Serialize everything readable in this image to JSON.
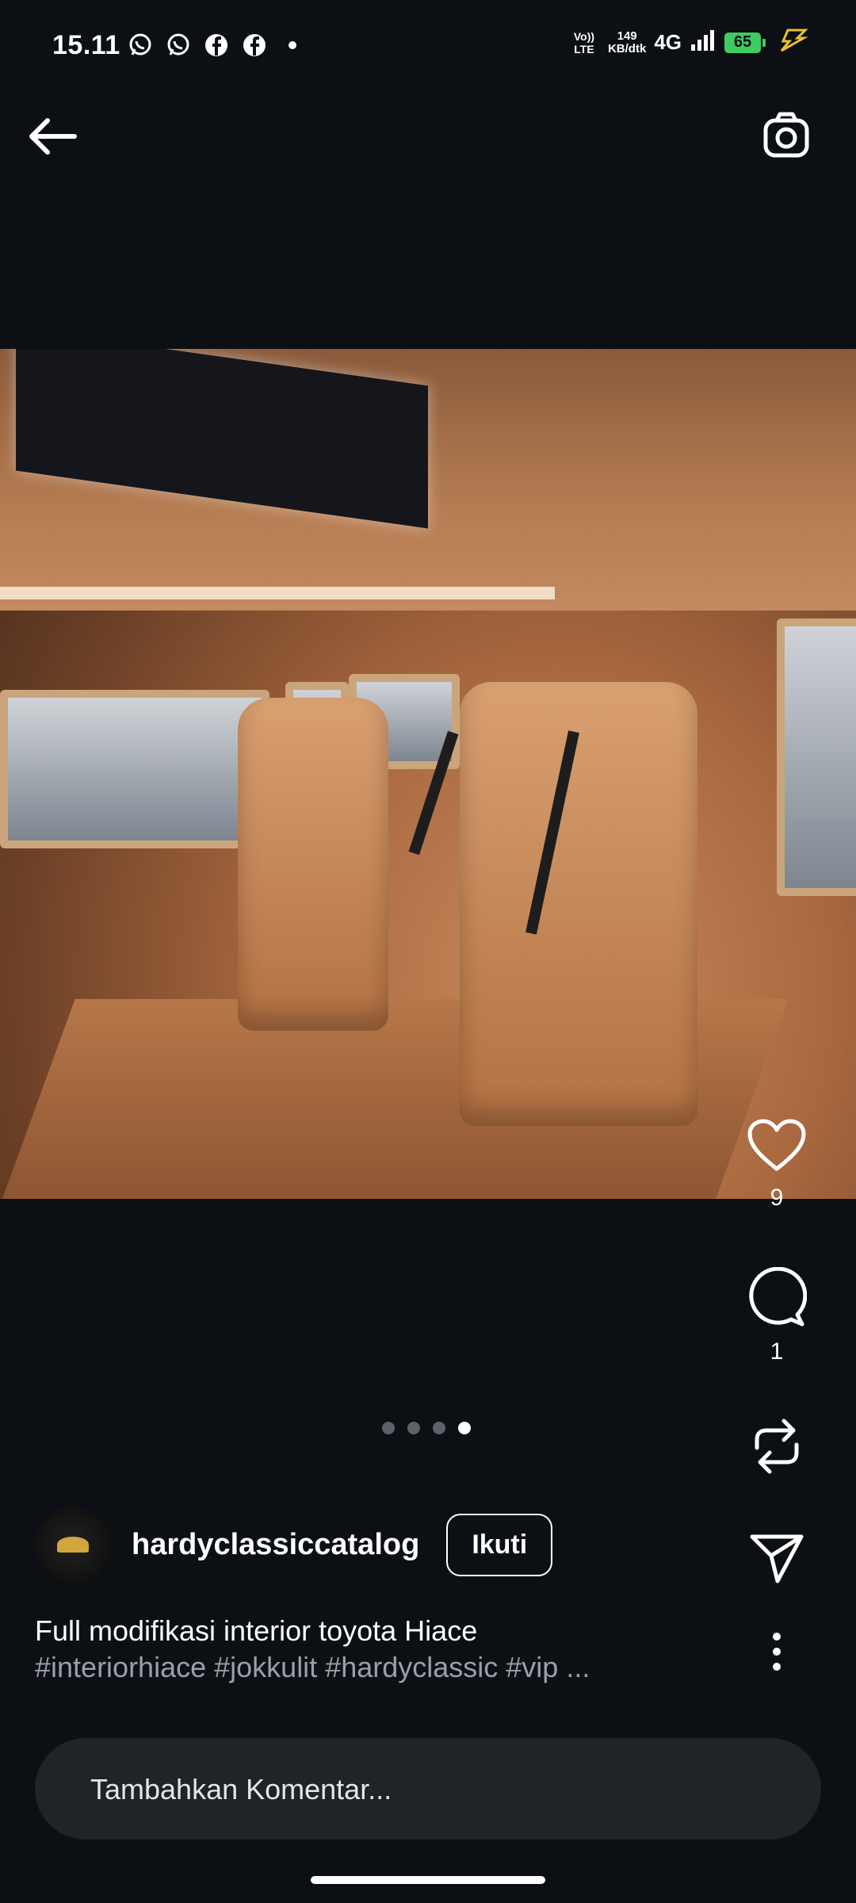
{
  "status_bar": {
    "time": "15.11",
    "net_speed": "149",
    "net_speed_unit": "KB/dtk",
    "network": "4G",
    "volte": "Vo)) LTE",
    "battery": "65",
    "notification_icons": [
      "whatsapp-icon",
      "whatsapp-icon",
      "facebook-icon",
      "facebook-icon",
      "dot-icon"
    ]
  },
  "post": {
    "likes": "9",
    "comments": "1",
    "image_count": 4,
    "active_image_index": 4,
    "author": "hardyclassiccatalog",
    "follow_label": "Ikuti",
    "caption": "Full modifikasi interior toyota Hiace",
    "hashtags": "#interiorhiace #jokkulit #hardyclassic #vip ..."
  },
  "comment_input": {
    "placeholder": "Tambahkan Komentar..."
  },
  "colors": {
    "background": "#0c0f14",
    "battery": "#3ecb62",
    "comment_box": "#202328"
  }
}
